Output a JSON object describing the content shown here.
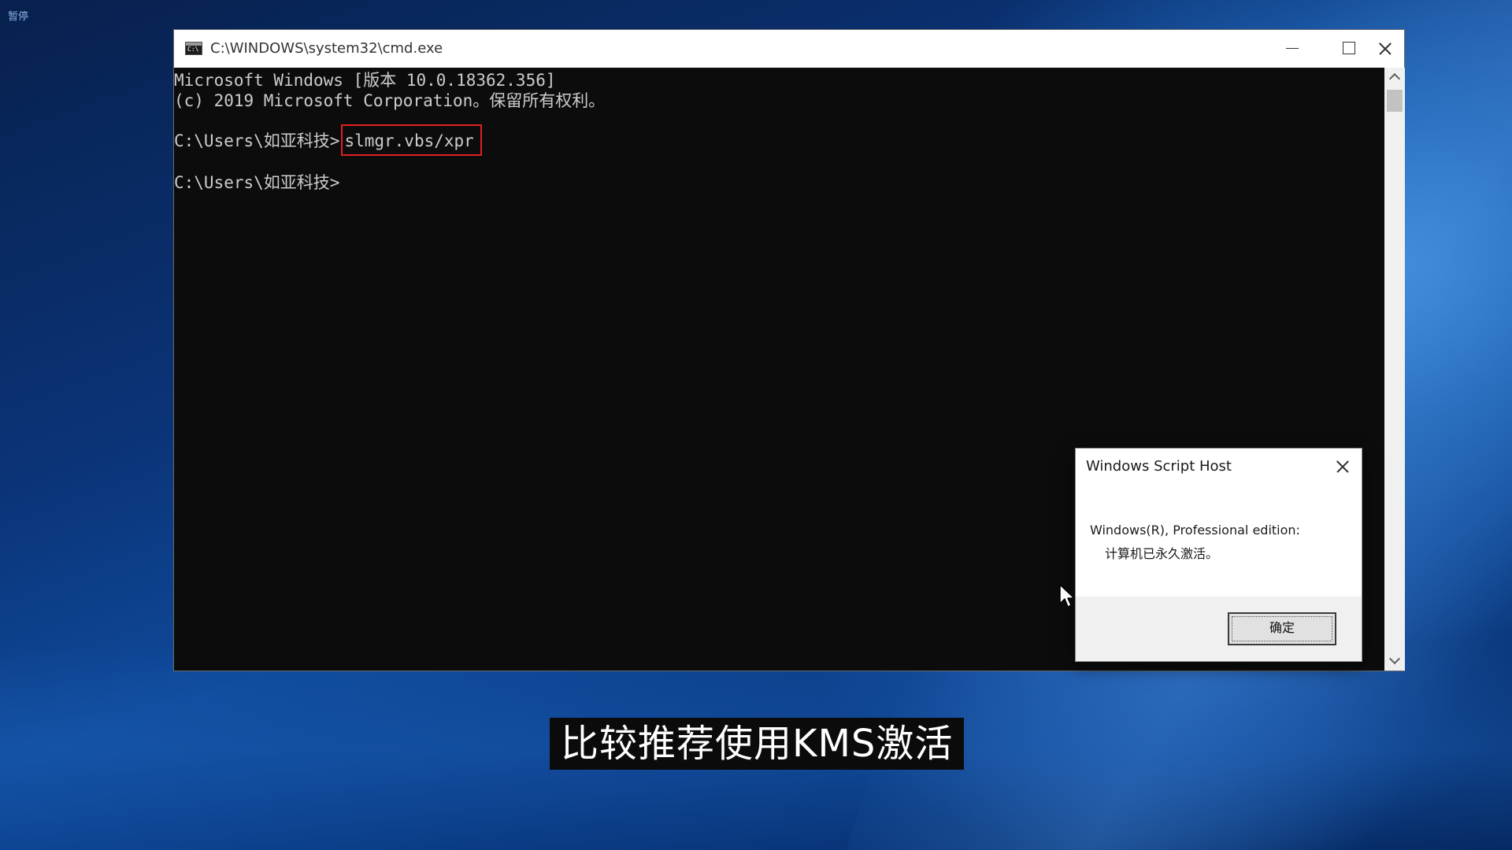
{
  "overlay": {
    "pause_label": "暂停"
  },
  "cmd_window": {
    "title": "C:\\WINDOWS\\system32\\cmd.exe",
    "icon": "cmd-icon",
    "console": {
      "line1": "Microsoft Windows [版本 10.0.18362.356]",
      "line2": "(c) 2019 Microsoft Corporation。保留所有权利。",
      "prompt1": "C:\\Users\\如亚科技>",
      "command": "slmgr.vbs/xpr",
      "prompt2": "C:\\Users\\如亚科技>"
    },
    "background_color": "#0c0c0c",
    "text_color": "#cccccc",
    "highlight_color": "#e02020"
  },
  "dialog": {
    "title": "Windows Script Host",
    "message_line1": "Windows(R), Professional edition:",
    "message_line2": "计算机已永久激活。",
    "ok_label": "确定"
  },
  "subtitle": {
    "text": "比较推荐使用KMS激活"
  }
}
